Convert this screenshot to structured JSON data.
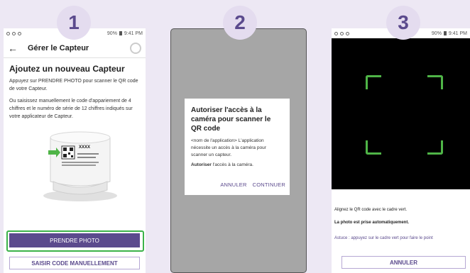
{
  "badges": [
    "1",
    "2",
    "3"
  ],
  "screen1": {
    "status_time": "9:41 PM",
    "status_battery": "90%",
    "header_title": "Gérer le Capteur",
    "back_icon": "←",
    "heading": "Ajoutez un nouveau Capteur",
    "paragraph1": "Appuyez sur PRENDRE PHOTO pour scanner le QR code de votre Capteur.",
    "paragraph2": "Ou saisissez manuellement le code d'appariement de 4 chiffres et le numéro de série de 12 chiffres indiqués sur votre applicateur de Capteur.",
    "sensor_label_code": "XXXX",
    "primary_button": "PRENDRE PHOTO",
    "secondary_button": "SAISIR CODE MANUELLEMENT",
    "highlight_color": "#3cb34a"
  },
  "screen2": {
    "dialog_title": "Autoriser l'accès à la caméra pour scanner le QR code",
    "dialog_body": "<nom de l'application> L'application nécessite un accès à la caméra pour scanner un capteur.",
    "dialog_auth_bold": "Autoriser",
    "dialog_auth_rest": " l'accès à la caméra.",
    "cancel_button": "ANNULER",
    "continue_button": "CONTINUER"
  },
  "screen3": {
    "status_time": "9:41 PM",
    "status_battery": "90%",
    "instruction1": "Alignez le QR code avec le cadre vert.",
    "instruction2": "La photo est prise automatiquement.",
    "hint": "Astuce : appuyez sur le cadre vert pour faire le point",
    "cancel_button": "ANNULER"
  },
  "colors": {
    "accent": "#5b4a8d",
    "badge_bg": "#e4dcef",
    "page_bg": "#ede8f4",
    "frame_green": "#4fb447"
  }
}
